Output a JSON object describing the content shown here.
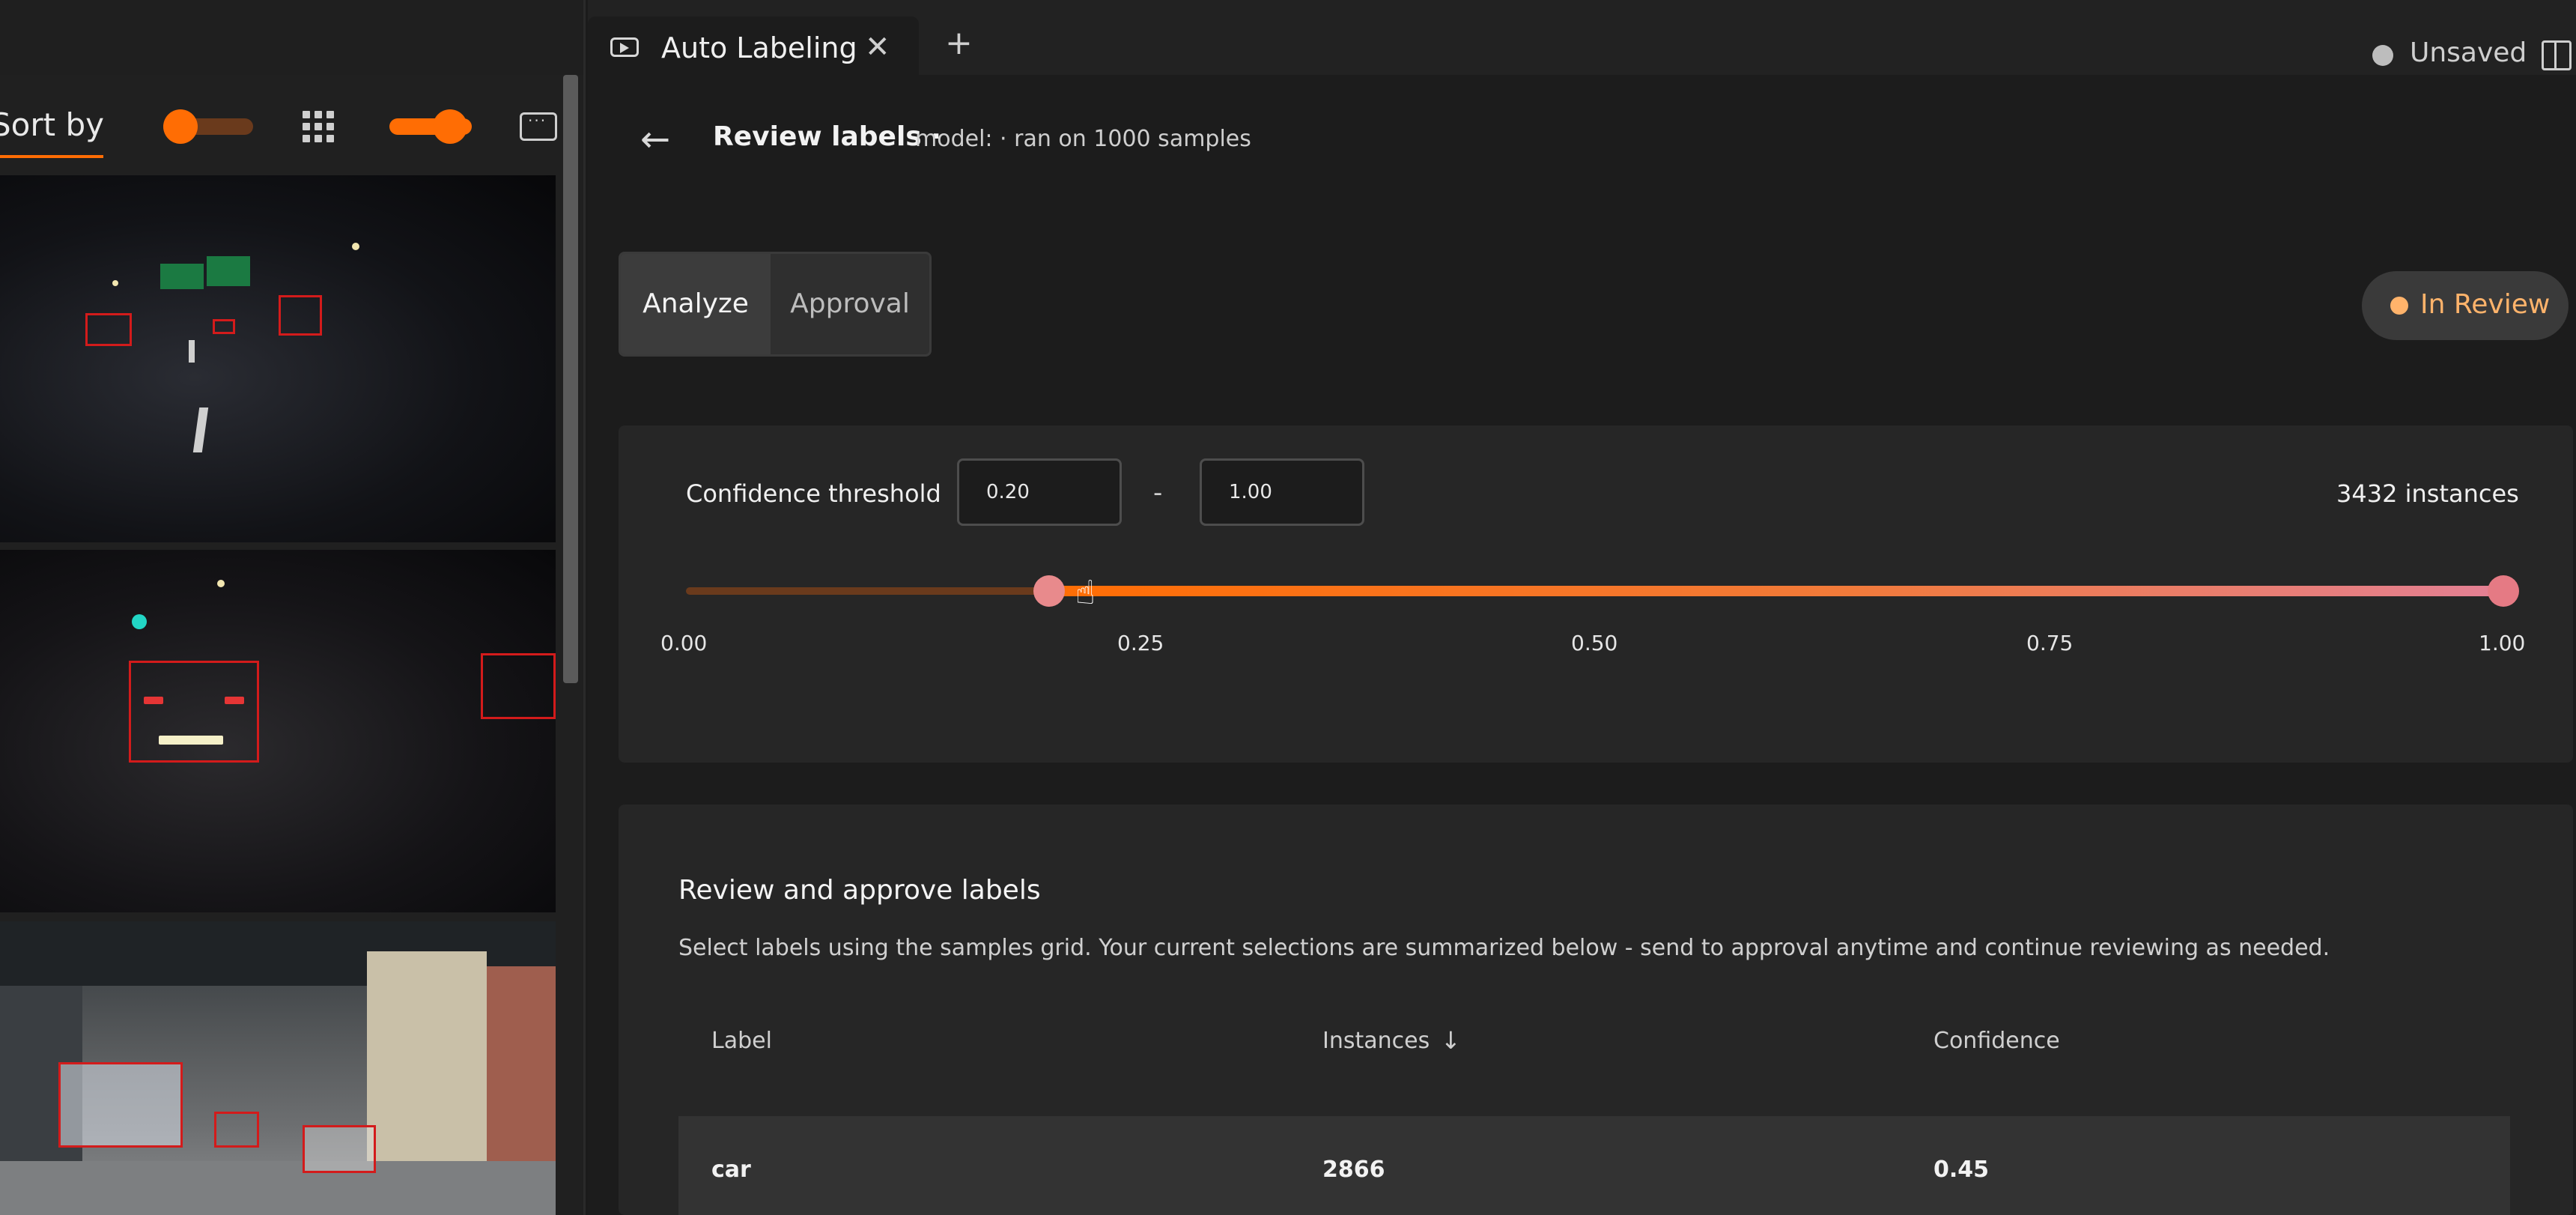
{
  "left_panel": {
    "sort_label": "Sort by"
  },
  "tab": {
    "label": "Auto Labeling",
    "close_glyph": "✕",
    "add_glyph": "+"
  },
  "status": {
    "unsaved": "Unsaved"
  },
  "header": {
    "back_glyph": "←",
    "title": "Review labels ·",
    "subtitle": "model: · ran on 1000 samples"
  },
  "segment": {
    "analyze": "Analyze",
    "approval": "Approval"
  },
  "badge": {
    "label": "In Review",
    "color": "#ffb36b"
  },
  "confidence": {
    "label": "Confidence threshold",
    "min_value": "0.20",
    "max_value": "1.00",
    "dash": "-",
    "instances": "3432 instances",
    "range_low": 0.2,
    "range_high": 1.0,
    "ticks": [
      "0.00",
      "0.25",
      "0.50",
      "0.75",
      "1.00"
    ],
    "accent": "#ff6d04"
  },
  "review": {
    "title": "Review and approve labels",
    "description": "Select labels using the samples grid. Your current selections are summarized below - send to approval anytime and continue reviewing as needed.",
    "columns": [
      "Label",
      "Instances",
      "Confidence"
    ],
    "sort_glyph": "↓",
    "rows": [
      {
        "label": "car",
        "instances": "2866",
        "confidence": "0.45"
      }
    ]
  },
  "icons": [
    "grid-icon",
    "keyboard-icon",
    "toggle-switch",
    "back-arrow-icon",
    "close-icon",
    "add-icon",
    "layout-icon",
    "cursor-hand-icon"
  ]
}
